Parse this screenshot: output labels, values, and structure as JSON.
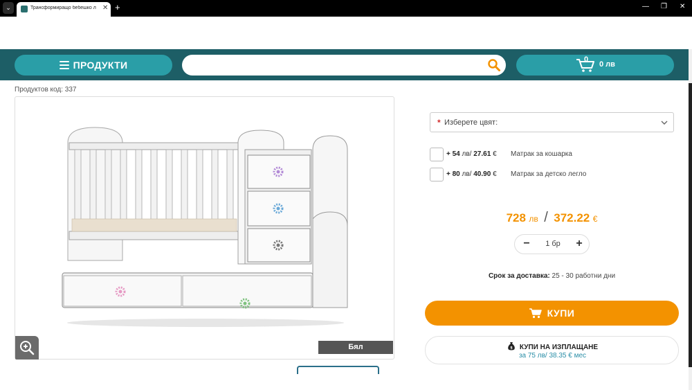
{
  "browser": {
    "tab_title": "Трансформиращо бебешко л",
    "new_tab_symbol": "+",
    "close_symbol": "✕",
    "controls": {
      "minimize": "—",
      "maximize": "❐",
      "close": "✕"
    }
  },
  "navbar": {
    "products_label": "ПРОДУКТИ",
    "search": {
      "value": "",
      "placeholder": ""
    },
    "cart": {
      "count": "0",
      "total": "0 лв"
    },
    "colors": {
      "bar": "#1d5e66",
      "button": "#2a9ea7",
      "accent": "#f39200"
    }
  },
  "product": {
    "code_text": "Продуктов код: 337",
    "color_badge": "Бял"
  },
  "options": {
    "color_select": {
      "required_mark": "*",
      "placeholder": "Изберете цвят:"
    },
    "addons": [
      {
        "sign": "+",
        "price_bgn": "54",
        "bgn": "лв/",
        "price_eur": "27.61",
        "eur": "€",
        "name": "Матрак за кошарка",
        "checked": false
      },
      {
        "sign": "+",
        "price_bgn": "80",
        "bgn": "лв/",
        "price_eur": "40.90",
        "eur": "€",
        "name": "Матрак за детско легло",
        "checked": false
      }
    ]
  },
  "price": {
    "bgn_value": "728",
    "bgn_currency": "лв",
    "separator": "/",
    "eur_value": "372.22",
    "eur_currency": "€"
  },
  "quantity": {
    "minus": "−",
    "value": "1 бр",
    "plus": "+"
  },
  "delivery": {
    "label": "Срок за доставка:",
    "value": "25 - 30 работни дни"
  },
  "buy": {
    "label": "КУПИ"
  },
  "leasing": {
    "title": "КУПИ НА ИЗПЛАЩАНЕ",
    "subtitle": "за 75 лв/ 38.35 € мес"
  }
}
